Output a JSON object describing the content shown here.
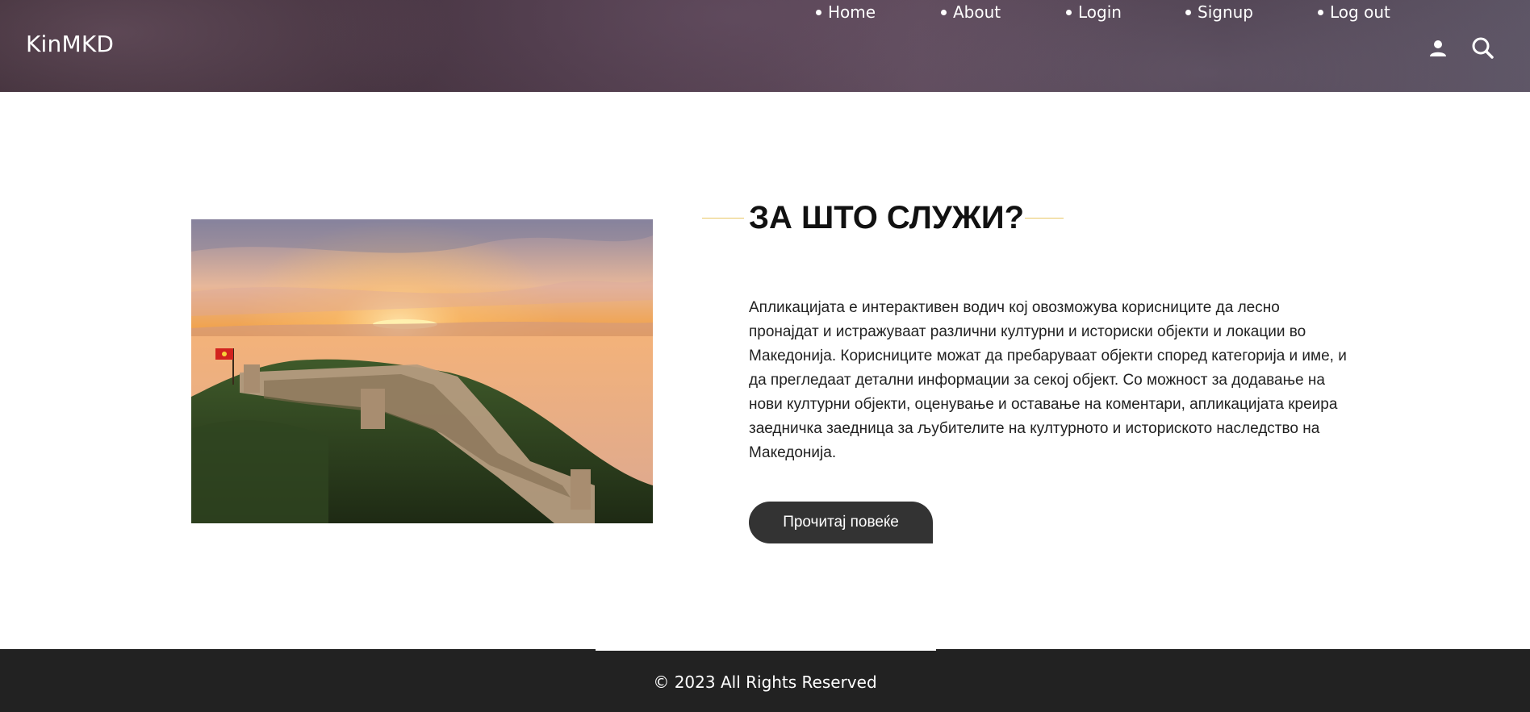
{
  "header": {
    "brand": "KinMKD",
    "nav": [
      {
        "label": "Home"
      },
      {
        "label": "About"
      },
      {
        "label": "Login"
      },
      {
        "label": "Signup"
      },
      {
        "label": "Log out"
      }
    ],
    "icons": [
      "user-icon",
      "search-icon"
    ]
  },
  "main": {
    "title": "ЗА ШТО СЛУЖИ?",
    "description": "Апликацијата е интерактивен водич кој овозможува корисниците да лесно пронајдат и истражуваат различни културни и историски објекти и локации во Македонија. Корисниците можат да пребаруваат објекти според категорија и име, и да прегледаат детални информации за секој објект. Со можност за додавање на нови културни објекти, оценување и оставање на коментари, апликацијата креира заедничка заедница за љубителите на културното и историското наследство на Македонија.",
    "button_label": "Прочитај повеќе",
    "accent_color": "#e9c865"
  },
  "footer": {
    "text": "© 2023 All Rights Reserved"
  }
}
